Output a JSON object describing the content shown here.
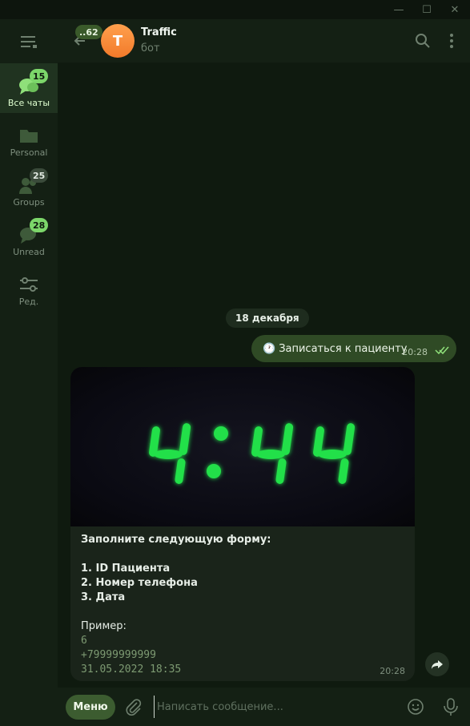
{
  "window": {
    "min_glyph": "—",
    "max_glyph": "☐",
    "close_glyph": "✕"
  },
  "sidebar": {
    "folders": [
      {
        "label": "Все чаты",
        "badge": "15",
        "active": true,
        "icon": "chats-icon"
      },
      {
        "label": "Personal",
        "badge": "",
        "active": false,
        "icon": "folder-icon"
      },
      {
        "label": "Groups",
        "badge": "25",
        "active": false,
        "icon": "users-icon"
      },
      {
        "label": "Unread",
        "badge": "28",
        "active": false,
        "icon": "chat-bubble-icon"
      },
      {
        "label": "Ред.",
        "badge": "",
        "active": false,
        "icon": "sliders-icon"
      }
    ]
  },
  "header": {
    "back_badge": "..62",
    "avatar_letter": "T",
    "title": "Traffic",
    "subtitle": "бот"
  },
  "chat": {
    "date_pill": "18 декабря",
    "outgoing": {
      "clock": "🕐",
      "text": "Записаться к пациенту",
      "time": "20:28"
    },
    "incoming": {
      "image_digits": "4:44",
      "line1": "Заполните следующую форму:",
      "item1": "1. ID Пациента",
      "item2": "2. Номер телефона",
      "item3": "3. Дата",
      "example_label": "Пример:",
      "example_id": "6",
      "example_phone": "+79999999999",
      "example_date": "31.05.2022 18:35",
      "time": "20:28"
    }
  },
  "composer": {
    "menu_label": "Меню",
    "placeholder": "Написать сообщение..."
  },
  "colors": {
    "accent": "#7cd66a",
    "outgoing_bubble": "#2f4a25",
    "digit_green": "#22e04a"
  }
}
